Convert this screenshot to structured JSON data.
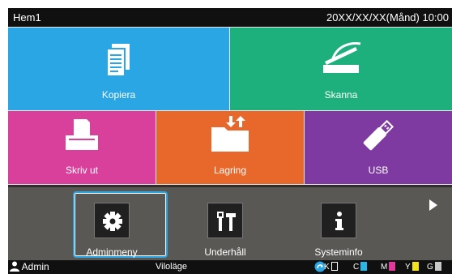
{
  "header": {
    "title": "Hem1",
    "datetime": "20XX/XX/XX(Månd) 10:00"
  },
  "tiles": [
    {
      "label": "Kopiera",
      "icon": "copy-document-icon",
      "color": "#2aa6e4"
    },
    {
      "label": "Skanna",
      "icon": "scanner-icon",
      "color": "#1eb07c"
    },
    {
      "label": "Skriv ut",
      "icon": "print-icon",
      "color": "#d9409b"
    },
    {
      "label": "Lagring",
      "icon": "storage-folder-icon",
      "color": "#e8672b"
    },
    {
      "label": "USB",
      "icon": "usb-icon",
      "color": "#7e3aa0"
    }
  ],
  "apps": [
    {
      "label": "Adminmeny",
      "icon": "gear-icon",
      "focused": true
    },
    {
      "label": "Underhåll",
      "icon": "tools-icon"
    },
    {
      "label": "Systeminfo",
      "icon": "info-icon"
    }
  ],
  "status": {
    "user": "Admin",
    "state": "Viloläge",
    "ink": [
      {
        "label": "K",
        "color": "#ffffff"
      },
      {
        "label": "C",
        "color": "#29b6e8"
      },
      {
        "label": "M",
        "color": "#e23a9a"
      },
      {
        "label": "Y",
        "color": "#f3e21a"
      },
      {
        "label": "G",
        "color": "#c8c8c8"
      }
    ]
  }
}
